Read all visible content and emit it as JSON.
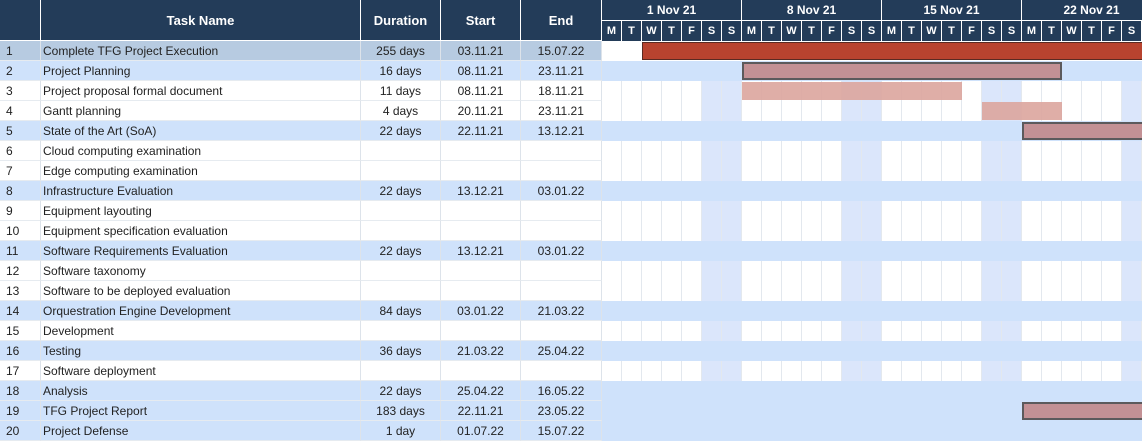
{
  "columns": {
    "task": "Task Name",
    "duration": "Duration",
    "start": "Start",
    "end": "End"
  },
  "weeks": [
    "1 Nov 21",
    "8 Nov 21",
    "15 Nov 21",
    "22 Nov 21"
  ],
  "day_letters": [
    "M",
    "T",
    "W",
    "T",
    "F",
    "S",
    "S"
  ],
  "colors": {
    "header": "#233c59",
    "summary_row": "#cfe2fb",
    "first_row": "#b7cbe1",
    "weekend": "#dbe6fb",
    "bar_main": "#b8432f",
    "bar_summary": "#c39195",
    "bar_task": "#dca59d"
  },
  "tasks": [
    {
      "id": "1",
      "name": "Complete TFG Project Execution",
      "duration": "255 days",
      "start": "03.11.21",
      "end": "15.07.22",
      "type": "main",
      "bar_start_day": 2,
      "bar_end_day": 27
    },
    {
      "id": "2",
      "name": "Project Planning",
      "duration": "16 days",
      "start": "08.11.21",
      "end": "23.11.21",
      "type": "summary",
      "bar_start_day": 7,
      "bar_end_day": 22
    },
    {
      "id": "3",
      "name": "Project proposal formal document",
      "duration": "11 days",
      "start": "08.11.21",
      "end": "18.11.21",
      "type": "task",
      "bar_start_day": 7,
      "bar_end_day": 17
    },
    {
      "id": "4",
      "name": "Gantt planning",
      "duration": "4 days",
      "start": "20.11.21",
      "end": "23.11.21",
      "type": "task",
      "bar_start_day": 19,
      "bar_end_day": 22
    },
    {
      "id": "5",
      "name": "State of the Art (SoA)",
      "duration": "22 days",
      "start": "22.11.21",
      "end": "13.12.21",
      "type": "summary",
      "bar_start_day": 21,
      "bar_end_day": 27
    },
    {
      "id": "6",
      "name": "Cloud computing examination",
      "duration": "",
      "start": "",
      "end": "",
      "type": "task"
    },
    {
      "id": "7",
      "name": "Edge computing examination",
      "duration": "",
      "start": "",
      "end": "",
      "type": "task"
    },
    {
      "id": "8",
      "name": "Infrastructure Evaluation",
      "duration": "22 days",
      "start": "13.12.21",
      "end": "03.01.22",
      "type": "summary"
    },
    {
      "id": "9",
      "name": "Equipment layouting",
      "duration": "",
      "start": "",
      "end": "",
      "type": "task"
    },
    {
      "id": "10",
      "name": "Equipment specification evaluation",
      "duration": "",
      "start": "",
      "end": "",
      "type": "task"
    },
    {
      "id": "11",
      "name": "Software Requirements Evaluation",
      "duration": "22 days",
      "start": "13.12.21",
      "end": "03.01.22",
      "type": "summary"
    },
    {
      "id": "12",
      "name": "Software taxonomy",
      "duration": "",
      "start": "",
      "end": "",
      "type": "task"
    },
    {
      "id": "13",
      "name": "Software to be deployed evaluation",
      "duration": "",
      "start": "",
      "end": "",
      "type": "task"
    },
    {
      "id": "14",
      "name": "Orquestration Engine Development",
      "duration": "84 days",
      "start": "03.01.22",
      "end": "21.03.22",
      "type": "summary"
    },
    {
      "id": "15",
      "name": "Development",
      "duration": "",
      "start": "",
      "end": "",
      "type": "task"
    },
    {
      "id": "16",
      "name": "Testing",
      "duration": "36 days",
      "start": "21.03.22",
      "end": "25.04.22",
      "type": "summary"
    },
    {
      "id": "17",
      "name": "Software deployment",
      "duration": "",
      "start": "",
      "end": "",
      "type": "task"
    },
    {
      "id": "18",
      "name": "Analysis",
      "duration": "22 days",
      "start": "25.04.22",
      "end": "16.05.22",
      "type": "summary"
    },
    {
      "id": "19",
      "name": "TFG Project Report",
      "duration": "183 days",
      "start": "22.11.21",
      "end": "23.05.22",
      "type": "summary",
      "bar_start_day": 21,
      "bar_end_day": 27
    },
    {
      "id": "20",
      "name": "Project Defense",
      "duration": "1 day",
      "start": "01.07.22",
      "end": "15.07.22",
      "type": "summary"
    }
  ]
}
